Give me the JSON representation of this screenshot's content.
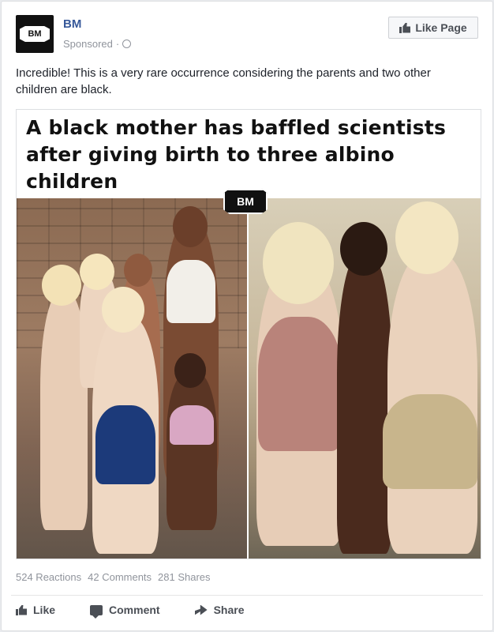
{
  "post": {
    "page_name": "BM",
    "avatar_text": "BM",
    "sponsored_label": "Sponsored",
    "sponsored_sep": "·",
    "like_page_label": "Like Page",
    "caption": "Incredible! This is a very rare occurrence considering the parents and two other children are black."
  },
  "image": {
    "headline": "A black mother has baffled scientists after giving birth to three albino children",
    "logo_text": "BM"
  },
  "stats": {
    "reactions": "524 Reactions",
    "comments": "42 Comments",
    "shares": "281 Shares"
  },
  "actions": {
    "like": "Like",
    "comment": "Comment",
    "share": "Share"
  },
  "icons": [
    "globe-icon",
    "thumbs-up-icon",
    "comment-icon",
    "share-icon"
  ]
}
